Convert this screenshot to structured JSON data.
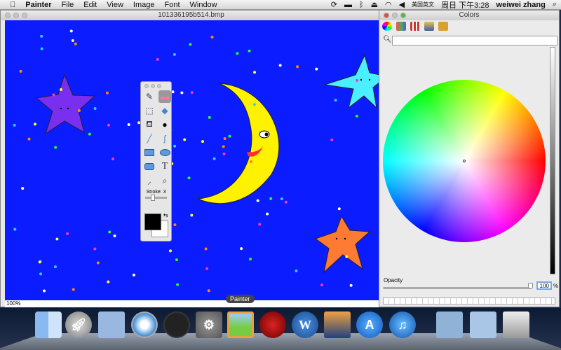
{
  "menubar": {
    "apple": "",
    "app": "Painter",
    "items": [
      "File",
      "Edit",
      "View",
      "Image",
      "Font",
      "Window"
    ],
    "input": "美国英文",
    "clock": "周日 下午3:28",
    "user": "weiwei zhang"
  },
  "document": {
    "title": "101336195b514.bmp",
    "zoom": "100%"
  },
  "toolbox": {
    "tools": [
      "brush",
      "eraser",
      "marquee",
      "smudge",
      "paint-bucket",
      "bomb",
      "line",
      "curve",
      "rectangle",
      "ellipse",
      "rounded-rectangle",
      "text",
      "eyedropper",
      "magnifier"
    ],
    "stroke_label": "Stroke: 3",
    "stroke": 3,
    "fg": "#000000",
    "bg": "#ffffff",
    "text_tool": "T"
  },
  "colors": {
    "title": "Colors",
    "opacity_label": "Opacity",
    "opacity": "100",
    "pct": "%"
  },
  "dock": {
    "tooltip": "Painter",
    "apps": [
      "Finder",
      "Launchpad",
      "Mail",
      "Safari",
      "Dashboard",
      "System Preferences",
      "Painter",
      "Acrobat",
      "Word",
      "iPhoto",
      "App Store",
      "iTunes",
      "Downloads",
      "Documents",
      "Trash"
    ],
    "w": "W"
  }
}
